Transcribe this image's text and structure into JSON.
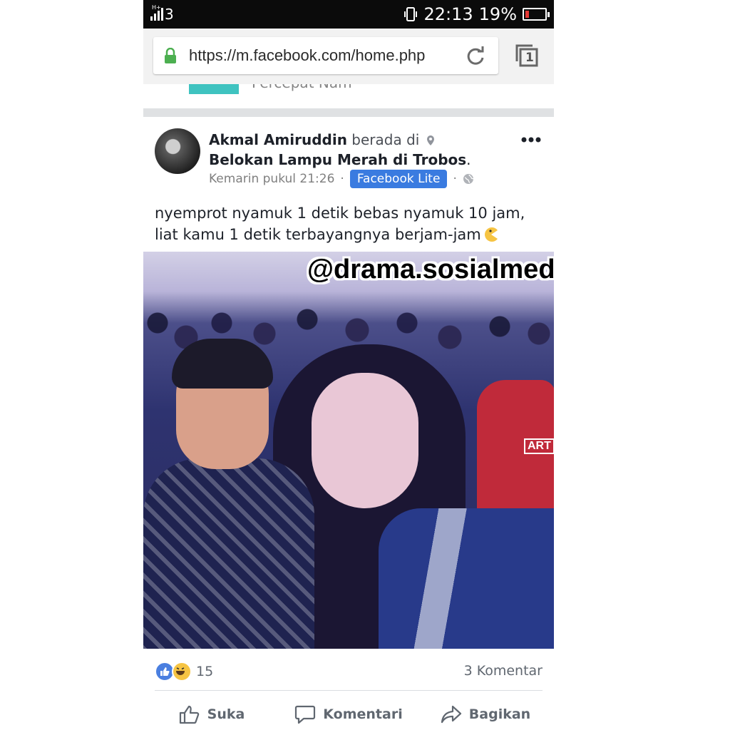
{
  "status_bar": {
    "network": "3",
    "network_sub": "H+",
    "time": "22:13",
    "battery_percent": "19%",
    "battery_level": 0.19,
    "battery_color": "#e53935"
  },
  "browser": {
    "url": "https://m.facebook.com/home.php",
    "tab_count": "1",
    "lock_color": "#4caf50"
  },
  "prev_post": {
    "partial_text": "Percepat Nam"
  },
  "post": {
    "author": "Akmal Amiruddin",
    "verb": "berada di",
    "location": "Belokan Lampu Merah di Trobos",
    "timestamp": "Kemarin pukul 21:26",
    "separator": "·",
    "app_badge": "Facebook Lite",
    "text_line1": "nyemprot nyamuk 1 detik bebas nyamuk 10 jam,",
    "text_line2": "liat kamu 1 detik terbayangnya berjam-jam",
    "watermark": "@drama.sosialmedia",
    "jacket_text": "ART",
    "reactions_count": "15",
    "comments": "3 Komentar"
  },
  "actions": {
    "like": "Suka",
    "comment": "Komentari",
    "share": "Bagikan"
  },
  "colors": {
    "facebook_blue": "#3a7be0",
    "text_dark": "#1d2129",
    "text_muted": "#606770"
  }
}
